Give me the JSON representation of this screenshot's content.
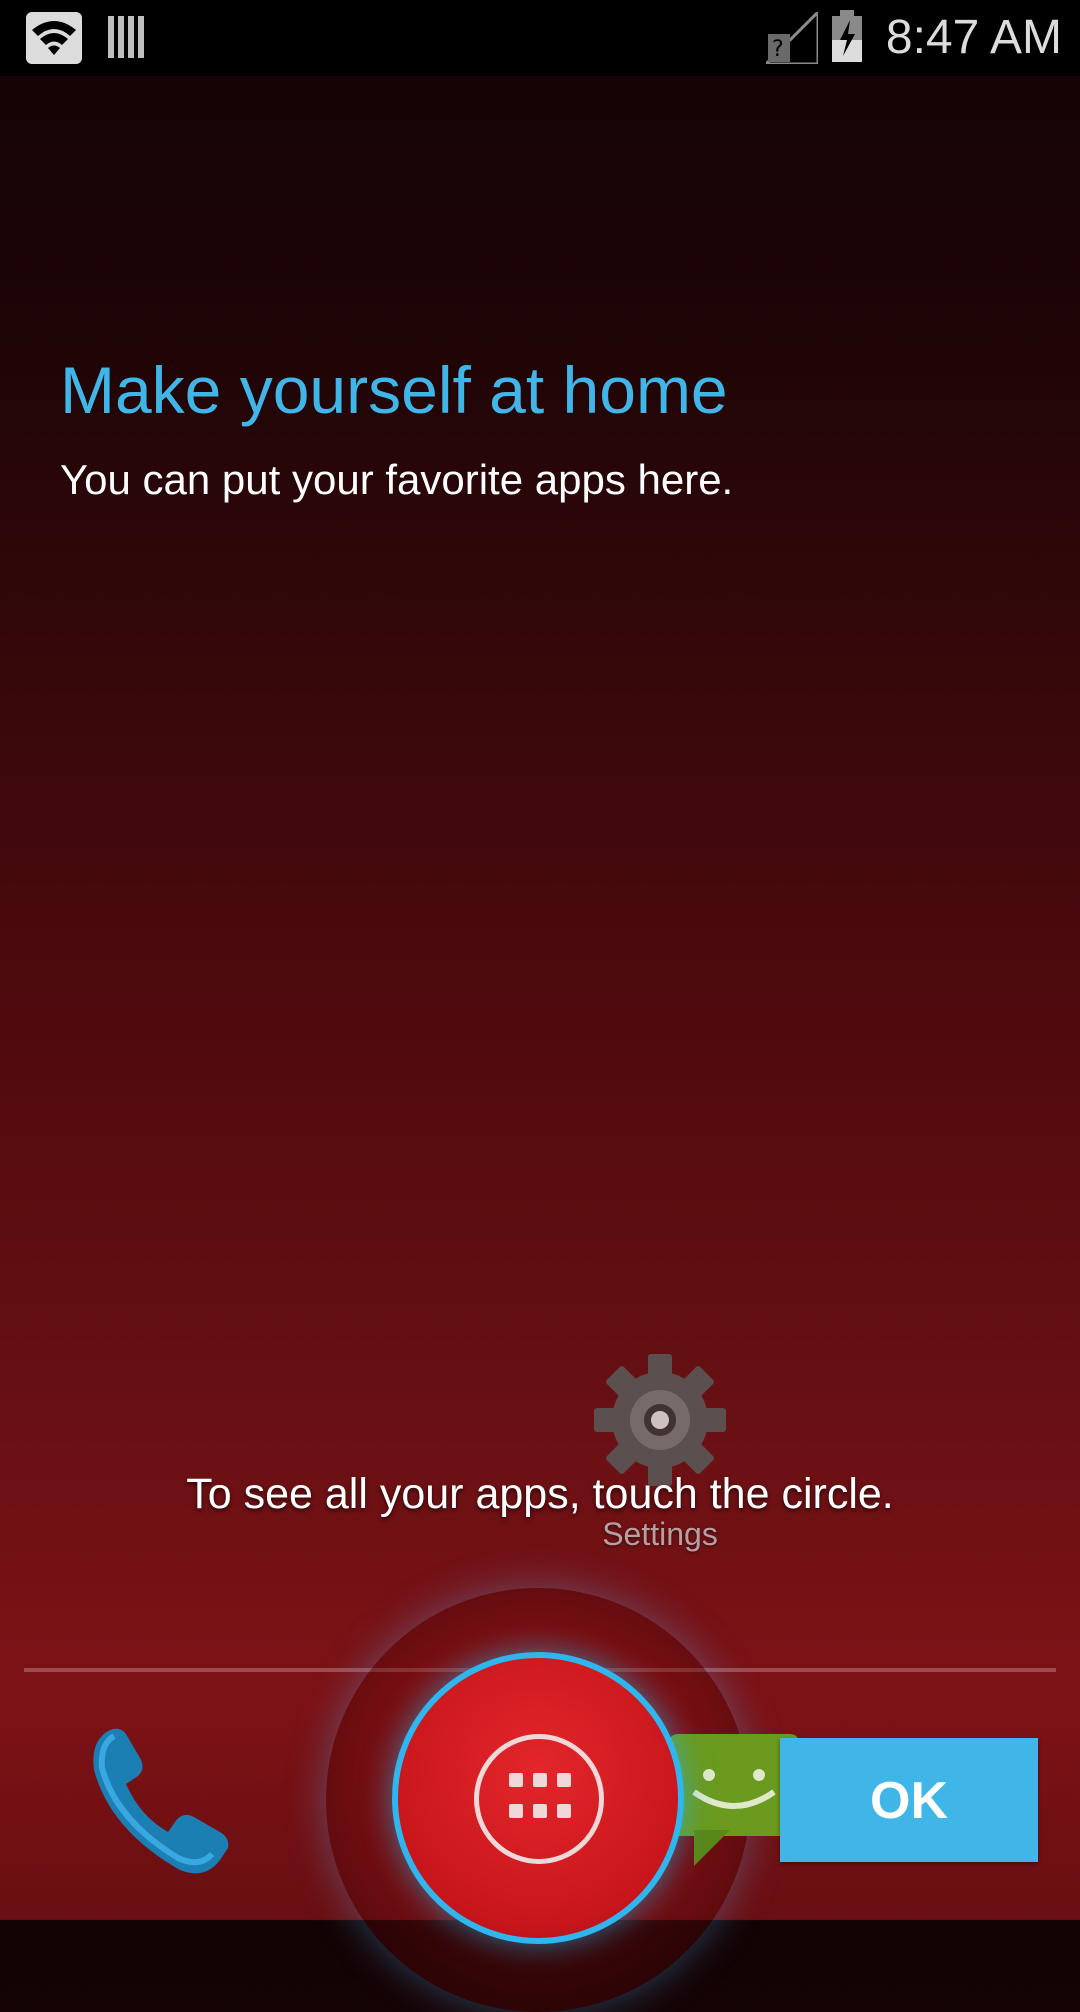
{
  "status_bar": {
    "time": "8:47 AM",
    "icons": [
      "wifi-icon",
      "storage-icon",
      "no-sim-signal-icon",
      "battery-charging-icon"
    ]
  },
  "intro": {
    "title": "Make yourself at home",
    "subtitle": "You can put your favorite apps here."
  },
  "hint": "To see all your apps, touch the circle.",
  "settings_app": {
    "label": "Settings",
    "icon": "gear-icon"
  },
  "dock": {
    "apps": [
      "phone-icon",
      "all-apps-icon",
      "messaging-icon"
    ]
  },
  "ok_button": {
    "label": "OK"
  },
  "colors": {
    "accent": "#40b6e8",
    "ring": "#2fb6ee",
    "circle": "#c8161c"
  }
}
